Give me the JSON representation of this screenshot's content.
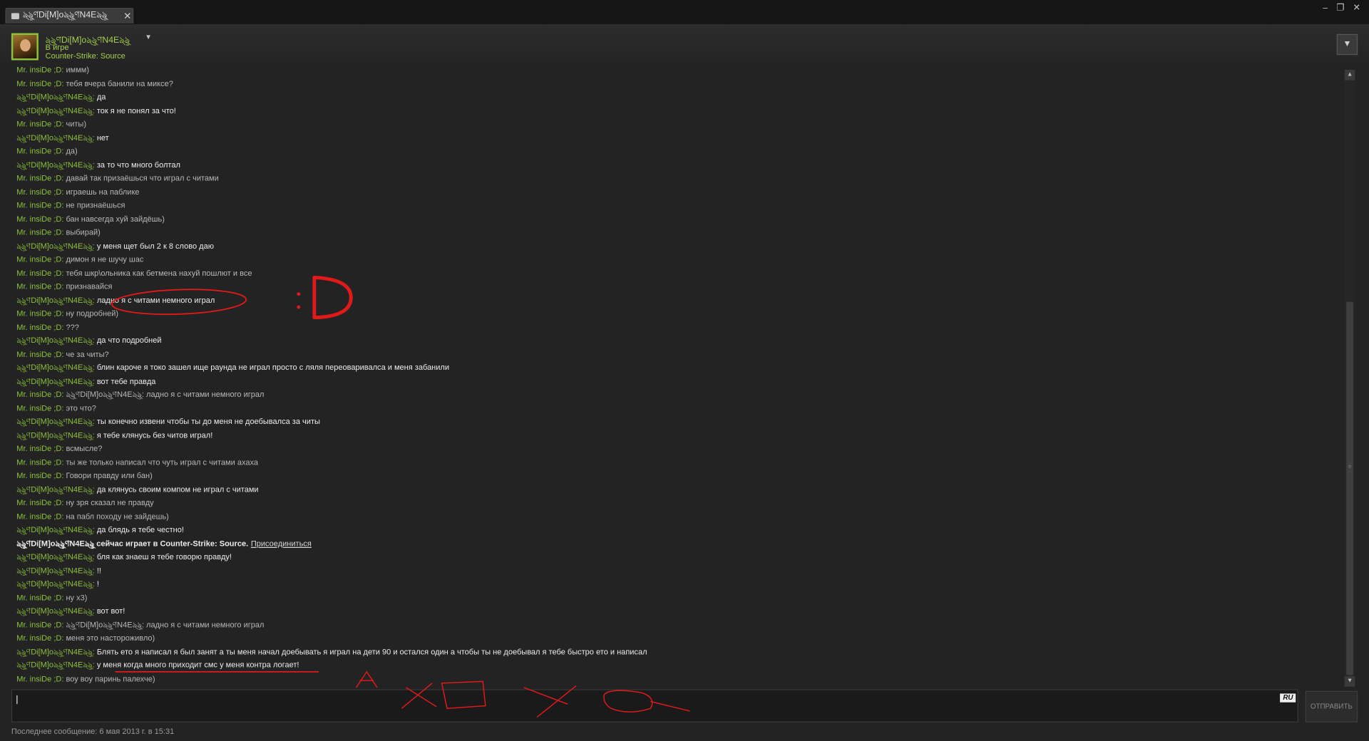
{
  "window": {
    "tab_title": "ঌ্ৡ্ণDi[M]oঌ্ৡ্ণN4Eঌ্ৡ্",
    "tab_close": "✕",
    "buttons": {
      "minimize": "‒",
      "restore": "❐",
      "close": "✕"
    }
  },
  "friend": {
    "name": "ঌ্ৡ্ণDi[M]oঌ্ৡ্ণN4Eঌ্ৡ্",
    "dropdown": "▼",
    "status": "В игре",
    "game": "Counter-Strike: Source",
    "menu_button": "▼"
  },
  "messages": [
    {
      "sender": "Mr. insiDe ;D:",
      "text": "иммм)",
      "self": false
    },
    {
      "sender": "Mr. insiDe ;D:",
      "text": "тебя вчера банили на миксе?",
      "self": false
    },
    {
      "sender": "ঌ্ৡ্ণDi[M]oঌ্ৡ্ণN4Eঌ্ৡ্:",
      "text": "да",
      "self": true
    },
    {
      "sender": "ঌ্ৡ্ণDi[M]oঌ্ৡ্ণN4Eঌ্ৡ্:",
      "text": "ток я не понял за что!",
      "self": true
    },
    {
      "sender": "Mr. insiDe ;D:",
      "text": "читы)",
      "self": false
    },
    {
      "sender": "ঌ্ৡ্ণDi[M]oঌ্ৡ্ণN4Eঌ্ৡ্:",
      "text": "нет",
      "self": true
    },
    {
      "sender": "Mr. insiDe ;D:",
      "text": "да)",
      "self": false
    },
    {
      "sender": "ঌ্ৡ্ণDi[M]oঌ্ৡ্ণN4Eঌ্ৡ্:",
      "text": "за то что много болтал",
      "self": true
    },
    {
      "sender": "Mr. insiDe ;D:",
      "text": "давай так призаёшься что играл с читами",
      "self": false
    },
    {
      "sender": "Mr. insiDe ;D:",
      "text": "играешь  на паблике",
      "self": false
    },
    {
      "sender": "Mr. insiDe ;D:",
      "text": "не признаёшься",
      "self": false
    },
    {
      "sender": "Mr. insiDe ;D:",
      "text": "бан навсегда хуй зайдёшь)",
      "self": false
    },
    {
      "sender": "Mr. insiDe ;D:",
      "text": "выбирай)",
      "self": false
    },
    {
      "sender": "ঌ্ৡ্ণDi[M]oঌ্ৡ্ণN4Eঌ্ৡ্:",
      "text": "у меня щет был 2 к 8 слово даю",
      "self": true
    },
    {
      "sender": "Mr. insiDe ;D:",
      "text": "димон я не шучу шас",
      "self": false
    },
    {
      "sender": "Mr. insiDe ;D:",
      "text": "тебя шкр\\ольника как бетмена нахуй пошлют и все",
      "self": false
    },
    {
      "sender": "Mr. insiDe ;D:",
      "text": "признавайся",
      "self": false
    },
    {
      "sender": "ঌ্ৡ্ণDi[M]oঌ্ৡ্ণN4Eঌ্ৡ্:",
      "text": "ладно я с читами немного играл",
      "self": true
    },
    {
      "sender": "Mr. insiDe ;D:",
      "text": "ну подробней)",
      "self": false
    },
    {
      "sender": "Mr. insiDe ;D:",
      "text": "???",
      "self": false
    },
    {
      "sender": "ঌ্ৡ্ণDi[M]oঌ্ৡ্ণN4Eঌ্ৡ্:",
      "text": "да что подробней",
      "self": true
    },
    {
      "sender": "Mr. insiDe ;D:",
      "text": "че за читы?",
      "self": false
    },
    {
      "sender": "ঌ্ৡ্ণDi[M]oঌ্ৡ্ণN4Eঌ্ৡ্:",
      "text": "блин кароче я токо зашел ище раунда не играл просто с ляля переоваривалса и меня забанили",
      "self": true
    },
    {
      "sender": "ঌ্ৡ্ণDi[M]oঌ্ৡ্ণN4Eঌ্ৡ্:",
      "text": "вот тебе правда",
      "self": true
    },
    {
      "sender": "Mr. insiDe ;D:",
      "text": "ঌ্ৡ্ণDi[M]oঌ্ৡ্ণN4Eঌ্ৡ্: ладно я с читами немного играл",
      "self": false
    },
    {
      "sender": "Mr. insiDe ;D:",
      "text": "это что?",
      "self": false
    },
    {
      "sender": "ঌ্ৡ্ণDi[M]oঌ্ৡ্ণN4Eঌ্ৡ্:",
      "text": "ты конечно извени чтобы ты до меня не доебывалса за читы",
      "self": true
    },
    {
      "sender": "ঌ্ৡ্ণDi[M]oঌ্ৡ্ণN4Eঌ্ৡ্:",
      "text": "я тебе клянусь без читов играл!",
      "self": true
    },
    {
      "sender": "Mr. insiDe ;D:",
      "text": "всмысле?",
      "self": false
    },
    {
      "sender": "Mr. insiDe ;D:",
      "text": "ты же только написал что чуть играл с читами ахаха",
      "self": false
    },
    {
      "sender": "Mr. insiDe ;D:",
      "text": "Говори правду или бан)",
      "self": false
    },
    {
      "sender": "ঌ্ৡ্ণDi[M]oঌ্ৡ্ণN4Eঌ্ৡ্:",
      "text": "да клянусь своим компом не играл с читами",
      "self": true
    },
    {
      "sender": "Mr. insiDe ;D:",
      "text": "ну зря сказал не правду",
      "self": false
    },
    {
      "sender": "Mr. insiDe ;D:",
      "text": "на пабл походу не зайдешь)",
      "self": false
    },
    {
      "sender": "ঌ্ৡ্ণDi[M]oঌ্ৡ্ণN4Eঌ্ৡ্:",
      "text": "да блядь я тебе честно!",
      "self": true
    },
    {
      "sender": "ঌ্ৡ্ণDi[M]oঌ্ৡ্ণN4Eঌ্ৡ্",
      "text": "сейчас играет в Counter-Strike: Source.",
      "system": true,
      "join": "Присоединиться"
    },
    {
      "sender": "ঌ্ৡ্ণDi[M]oঌ্ৡ্ণN4Eঌ্ৡ্:",
      "text": "бля как знаеш я тебе говорю правду!",
      "self": true
    },
    {
      "sender": "ঌ্ৡ্ণDi[M]oঌ্ৡ্ণN4Eঌ্ৡ্:",
      "text": "!!",
      "self": true
    },
    {
      "sender": "ঌ্ৡ্ণDi[M]oঌ্ৡ্ণN4Eঌ্ৡ্:",
      "text": "!",
      "self": true
    },
    {
      "sender": "Mr. insiDe ;D:",
      "text": "ну х3)",
      "self": false
    },
    {
      "sender": "ঌ্ৡ্ণDi[M]oঌ্ৡ্ণN4Eঌ্ৡ্:",
      "text": "вот вот!",
      "self": true
    },
    {
      "sender": "Mr. insiDe ;D:",
      "text": "ঌ্ৡ্ণDi[M]oঌ্ৡ্ণN4Eঌ্ৡ্: ладно я с читами немного играл",
      "self": false
    },
    {
      "sender": "Mr. insiDe ;D:",
      "text": "меня это настороживло)",
      "self": false
    },
    {
      "sender": "ঌ্ৡ্ণDi[M]oঌ্ৡ্ণN4Eঌ্ৡ্:",
      "text": "Блять ето я написал я был занят а ты меня начал доебывать я играл на дети 90 и остался один а чтобы ты не доебывал я тебе быстро ето и написал",
      "self": true
    },
    {
      "sender": "ঌ্ৡ্ণDi[M]oঌ্ৡ্ণN4Eঌ্ৡ্:",
      "text": "у меня когда много приходит смс у меня контра логает!",
      "self": true
    },
    {
      "sender": "Mr. insiDe ;D:",
      "text": "воу воу паринь палехче)",
      "self": false
    }
  ],
  "input": {
    "value": "",
    "lang": "RU"
  },
  "send_button": "ОТПРАВИТЬ",
  "last_message": "Последнее сообщение: 6 мая 2013 г. в 15:31",
  "scrollbar": {
    "up": "▲",
    "down": "▼",
    "grip": "≡"
  },
  "colors": {
    "accent_green": "#8cc23c",
    "annotation_red": "#e01a1a"
  }
}
